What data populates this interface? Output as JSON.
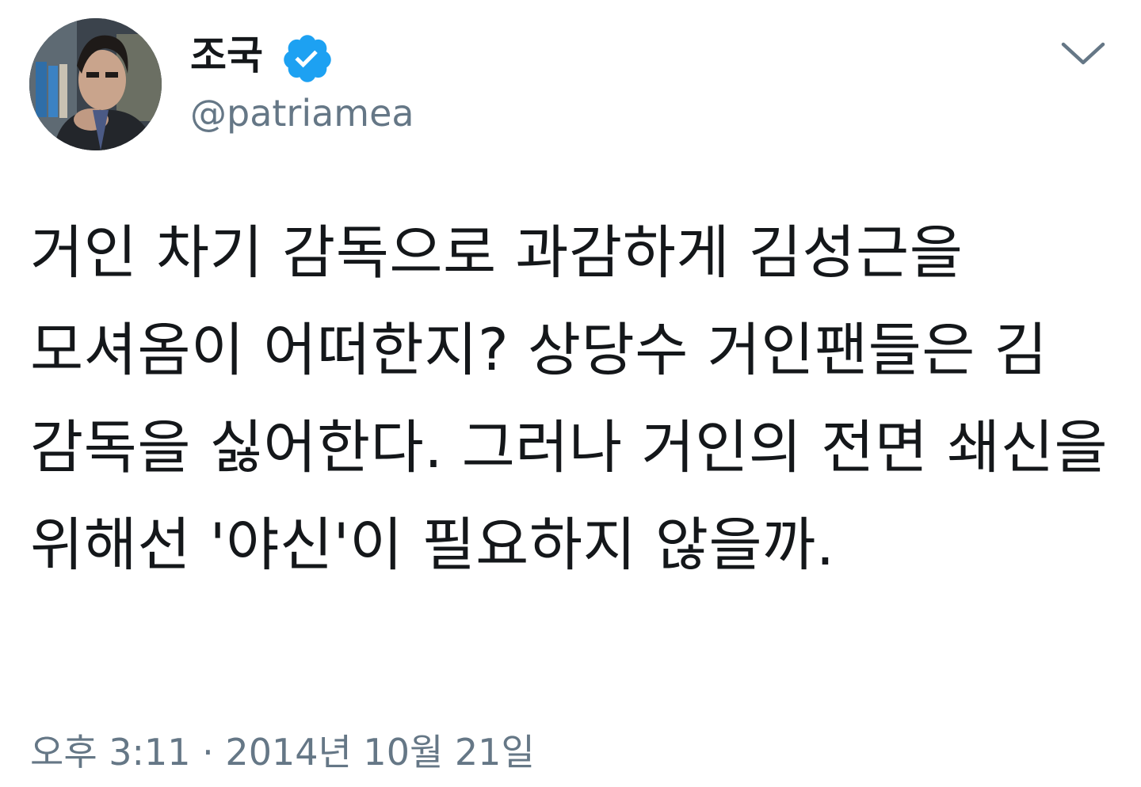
{
  "tweet": {
    "author": {
      "display_name": "조국",
      "handle": "@patriamea",
      "verified": true,
      "verified_badge_color": "#1da1f2"
    },
    "text": "거인 차기 감독으로 과감하게 김성근을 모셔옴이 어떠한지? 상당수 거인팬들은 김 감독을 싫어한다. 그러나 거인의 전면 쇄신을 위해선 '야신'이 필요하지 않을까.",
    "timestamp": "오후 3:11 · 2014년 10월 21일",
    "menu_icon": "chevron-down-icon"
  },
  "colors": {
    "text_primary": "#14171a",
    "text_secondary": "#657786",
    "accent": "#1da1f2",
    "background": "#ffffff"
  }
}
